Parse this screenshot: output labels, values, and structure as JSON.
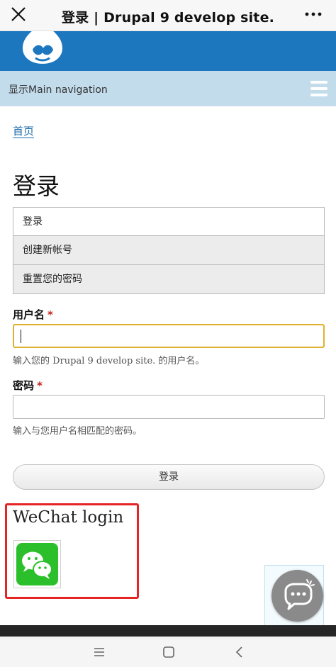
{
  "app_bar": {
    "title": "登录 | Drupal 9 develop site.",
    "close_icon": "close-icon",
    "more_icon": "more-dots-icon"
  },
  "site_header": {
    "logo": "drupal-logo",
    "brand_color": "#1c77bf"
  },
  "main_nav": {
    "label": "显示Main navigation",
    "menu_icon": "hamburger-icon",
    "background": "#c3dcec"
  },
  "breadcrumb": {
    "home": "首页"
  },
  "page": {
    "title": "登录"
  },
  "tabs": [
    {
      "label": "登录"
    },
    {
      "label": "创建新帐号"
    },
    {
      "label": "重置您的密码"
    }
  ],
  "form": {
    "username": {
      "label": "用户名",
      "required_mark": "*",
      "value": "",
      "description": "输入您的 Drupal 9 develop site. 的用户名。"
    },
    "password": {
      "label": "密码",
      "required_mark": "*",
      "value": "",
      "description": "输入与您用户名相匹配的密码。"
    },
    "submit_label": "登录"
  },
  "wechat": {
    "title": "WeChat login",
    "icon": "wechat-icon",
    "highlight_color": "#e52424"
  },
  "floating_chat": {
    "icon": "chat-bubble-icon"
  },
  "system_nav": {
    "menu_icon": "menu-icon",
    "home_icon": "home-square-icon",
    "back_icon": "back-chevron-icon"
  }
}
